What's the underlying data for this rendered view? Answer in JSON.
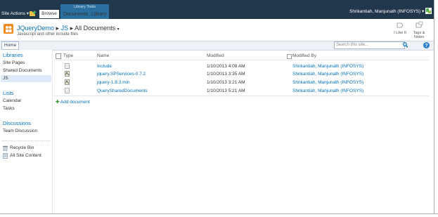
{
  "ribbon": {
    "site_actions": "Site Actions",
    "browse_tab": "Browse",
    "library_tools": "Library Tools",
    "documents_tab": "Documents",
    "library_tab": "Library",
    "user_name": "Shrikantiah, Manjunath (INFOSYS)"
  },
  "title": {
    "site": "JQueryDemo",
    "folder": "JS",
    "view": "All Documents",
    "description": "Javascript and other include files",
    "i_like_it": "I Like It",
    "tags_notes": "Tags & Notes"
  },
  "topnav": {
    "home": "Home",
    "search_placeholder": "Search this site..."
  },
  "quick_launch": {
    "libraries_head": "Libraries",
    "site_pages": "Site Pages",
    "shared_documents": "Shared Documents",
    "js": "JS",
    "lists_head": "Lists",
    "calendar": "Calendar",
    "tasks": "Tasks",
    "discussions_head": "Discussions",
    "team_discussion": "Team Discussion",
    "recycle_bin": "Recycle Bin",
    "all_site_content": "All Site Content"
  },
  "list": {
    "columns": {
      "type": "Type",
      "name": "Name",
      "modified": "Modified",
      "modified_by": "Modified By"
    },
    "rows": [
      {
        "type": "folder",
        "name": "Include",
        "modified": "1/10/2013 4:08 AM",
        "modified_by": "Shrikantiah, Manjunath (INFOSYS)"
      },
      {
        "type": "js",
        "name": "jquery.SPServices-0.7.2",
        "modified": "1/10/2013 3:35 AM",
        "modified_by": "Shrikantiah, Manjunath (INFOSYS)"
      },
      {
        "type": "js",
        "name": "jquery-1.8.3.min",
        "modified": "1/10/2013 3:21 AM",
        "modified_by": "Shrikantiah, Manjunath (INFOSYS)"
      },
      {
        "type": "doc",
        "name": "QuerySharedDocuments",
        "modified": "1/10/2013 5:21 AM",
        "modified_by": "Shrikantiah, Manjunath (INFOSYS)"
      }
    ],
    "add_document": "Add document"
  },
  "colors": {
    "ribbon": "#21374c",
    "link": "#0072bc",
    "selected_nav": "#dcebf7"
  }
}
